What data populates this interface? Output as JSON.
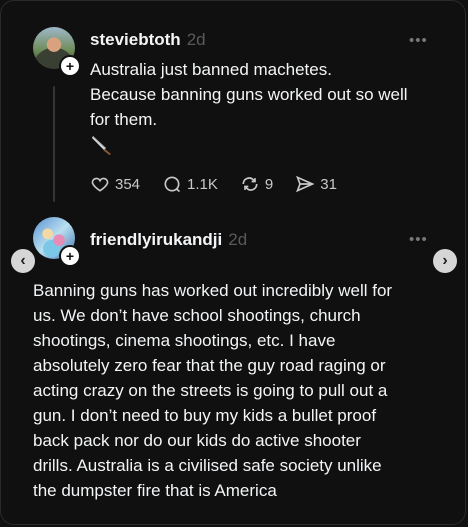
{
  "post1": {
    "username": "steviebtoth",
    "time": "2d",
    "lines": [
      "Australia just banned machetes.",
      "Because banning guns worked out so well",
      "for them."
    ],
    "emoji": "knife-emoji",
    "stats": {
      "likes": "354",
      "comments": "1.1K",
      "reposts": "9",
      "shares": "31"
    }
  },
  "post2": {
    "username": "friendlyirukandji",
    "time": "2d",
    "lines": [
      "Banning guns has worked out incredibly well for",
      "us. We don’t have school shootings, church",
      "shootings, cinema shootings, etc. I have",
      "absolutely zero fear that the guy road raging or",
      "acting crazy on the streets is going to pull out a",
      "gun. I don’t need to buy my kids a bullet proof",
      "back pack nor do our kids do active shooter",
      "drills. Australia is a civilised safe society unlike",
      "the dumpster fire that is America"
    ]
  },
  "ui": {
    "more": "•••",
    "plus": "+",
    "prev": "‹",
    "next": "›"
  },
  "colors": {
    "background": "#101010",
    "text": "#f3f5f7",
    "muted": "#5a5a5a"
  }
}
